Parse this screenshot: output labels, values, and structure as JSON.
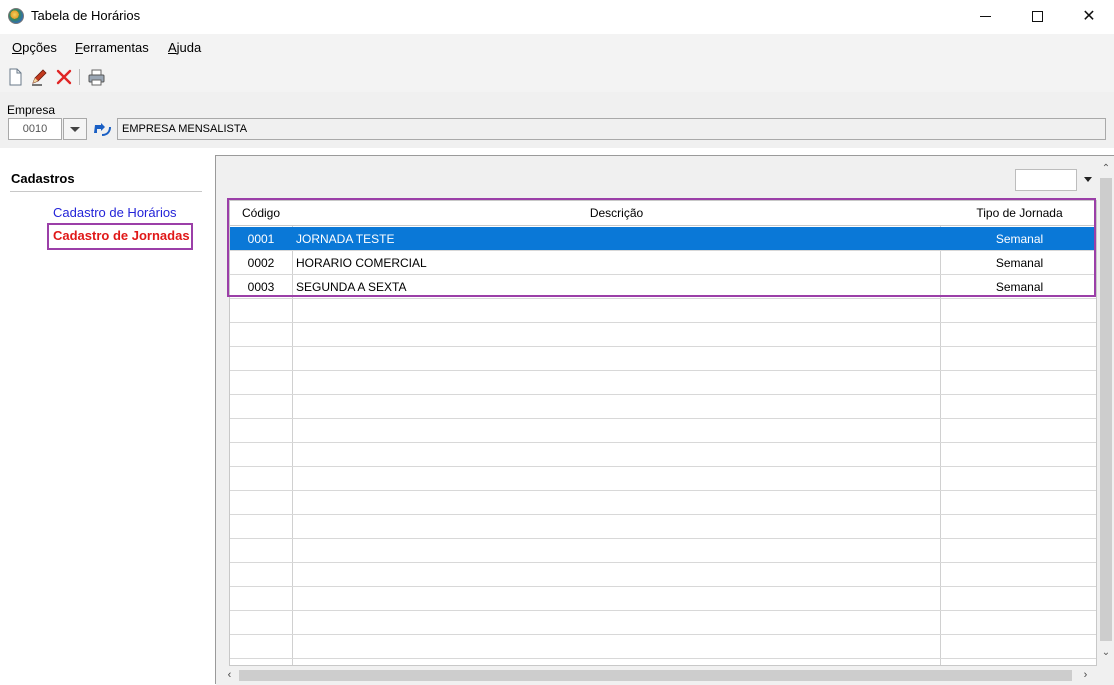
{
  "window": {
    "title": "Tabela de Horários"
  },
  "menu": {
    "items": [
      {
        "key": "O",
        "rest": "pções"
      },
      {
        "key": "F",
        "rest": "erramentas"
      },
      {
        "key": "A",
        "rest": "juda"
      }
    ]
  },
  "toolbar": {
    "icons": [
      "new-document-icon",
      "edit-icon",
      "delete-icon",
      "print-icon"
    ]
  },
  "empresa": {
    "label": "Empresa",
    "code": "0010",
    "name": "EMPRESA MENSALISTA"
  },
  "sidebar": {
    "title": "Cadastros",
    "items": [
      {
        "label": "Cadastro de Horários"
      },
      {
        "label": "Cadastro de Jornadas"
      }
    ]
  },
  "table": {
    "columns": [
      "Código",
      "Descrição",
      "Tipo de Jornada"
    ],
    "rows": [
      {
        "codigo": "0001",
        "descricao": "JORNADA TESTE",
        "tipo": "Semanal"
      },
      {
        "codigo": "0002",
        "descricao": "HORARIO COMERCIAL",
        "tipo": "Semanal"
      },
      {
        "codigo": "0003",
        "descricao": "SEGUNDA A SEXTA",
        "tipo": "Semanal"
      }
    ]
  },
  "colors": {
    "selection": "#0a78d7",
    "highlight": "#9b3fa8",
    "active_link": "#e01818",
    "link": "#2323d8"
  }
}
